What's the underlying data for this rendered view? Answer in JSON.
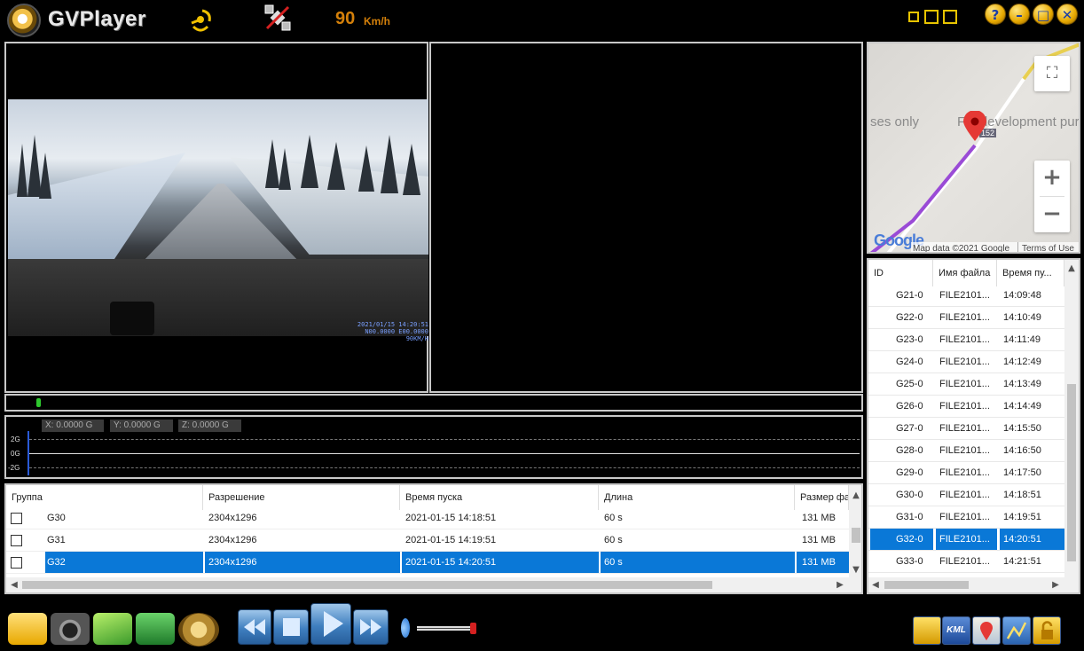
{
  "app": {
    "title": "GVPlayer"
  },
  "header": {
    "speed_value": "90",
    "speed_unit": "Km/h",
    "icons": [
      "gps-signal-icon",
      "satellite-icon"
    ],
    "window_buttons": [
      {
        "name": "help-button",
        "glyph": "?"
      },
      {
        "name": "minimize-button",
        "glyph": "–"
      },
      {
        "name": "maximize-button",
        "glyph": "□"
      },
      {
        "name": "close-button",
        "glyph": "✕"
      }
    ]
  },
  "video": {
    "stamp_line1": "2021/01/15 14:20:51",
    "stamp_line2": "N00.0000 E00.0000 90KM/H"
  },
  "gsensor": {
    "x_label": "X: 0.0000 G",
    "y_label": "Y: 0.0000 G",
    "z_label": "Z: 0.0000 G",
    "scale_top": "2G",
    "scale_mid": "0G",
    "scale_bot": "-2G"
  },
  "map": {
    "label_left": "ses only",
    "label_right": "Fo  development pur",
    "road_badge": "152",
    "footer_data": "Map data ©2021 Google",
    "footer_terms": "Terms of Use",
    "logo": "Google",
    "zoom_in": "+",
    "zoom_out": "−",
    "fullscreen": "⛶"
  },
  "file_list": {
    "columns": [
      "ID",
      "Имя файла",
      "Время пу..."
    ],
    "rows": [
      {
        "id": "G21-0",
        "file": "FILE2101...",
        "time": "14:09:48"
      },
      {
        "id": "G22-0",
        "file": "FILE2101...",
        "time": "14:10:49"
      },
      {
        "id": "G23-0",
        "file": "FILE2101...",
        "time": "14:11:49"
      },
      {
        "id": "G24-0",
        "file": "FILE2101...",
        "time": "14:12:49"
      },
      {
        "id": "G25-0",
        "file": "FILE2101...",
        "time": "14:13:49"
      },
      {
        "id": "G26-0",
        "file": "FILE2101...",
        "time": "14:14:49"
      },
      {
        "id": "G27-0",
        "file": "FILE2101...",
        "time": "14:15:50"
      },
      {
        "id": "G28-0",
        "file": "FILE2101...",
        "time": "14:16:50"
      },
      {
        "id": "G29-0",
        "file": "FILE2101...",
        "time": "14:17:50"
      },
      {
        "id": "G30-0",
        "file": "FILE2101...",
        "time": "14:18:51"
      },
      {
        "id": "G31-0",
        "file": "FILE2101...",
        "time": "14:19:51"
      },
      {
        "id": "G32-0",
        "file": "FILE2101...",
        "time": "14:20:51",
        "selected": true
      },
      {
        "id": "G33-0",
        "file": "FILE2101...",
        "time": "14:21:51"
      }
    ]
  },
  "group_table": {
    "columns": [
      "Группа",
      "Разрешение",
      "Время пуска",
      "Длина",
      "Размер фай"
    ],
    "rows": [
      {
        "group": "G30",
        "resolution": "2304x1296",
        "start": "2021-01-15 14:18:51",
        "length": "60 s",
        "size": "131 MB"
      },
      {
        "group": "G31",
        "resolution": "2304x1296",
        "start": "2021-01-15 14:19:51",
        "length": "60 s",
        "size": "131 MB"
      },
      {
        "group": "G32",
        "resolution": "2304x1296",
        "start": "2021-01-15 14:20:51",
        "length": "60 s",
        "size": "131 MB",
        "selected": true
      }
    ]
  },
  "toolbar": {
    "left_tools": [
      "open-folder-icon",
      "camera-snapshot-icon",
      "save-disk-icon",
      "recycle-bin-icon",
      "settings-gear-icon"
    ],
    "playback": [
      "rewind-button",
      "stop-button",
      "play-button",
      "fast-forward-button"
    ],
    "volume_level": 0.95,
    "right_tools": [
      "export-button",
      "kml-button",
      "map-button",
      "graph-button",
      "lock-button"
    ],
    "kml_label": "KML"
  },
  "colors": {
    "selection": "#0a78d7",
    "speed": "#d4800a",
    "gold": "#e8c400"
  }
}
